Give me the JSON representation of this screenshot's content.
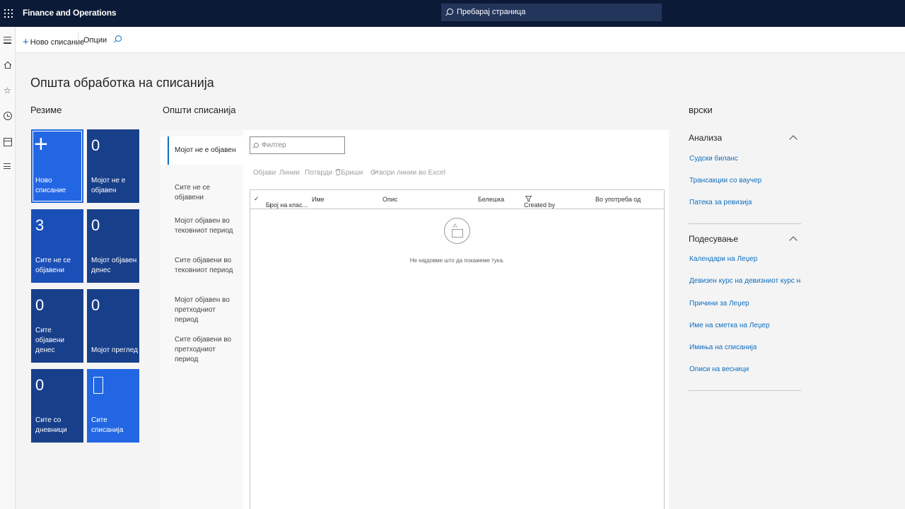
{
  "app": {
    "title": "Finance and Operations"
  },
  "search": {
    "placeholder": "Пребарај страница"
  },
  "actionbar": {
    "new_label": "Ново списание",
    "options_label": "Опции"
  },
  "page": {
    "title": "Општа обработка на списанија"
  },
  "summary": {
    "heading": "Резиме",
    "tiles": [
      {
        "count": "",
        "label": "Ново списание"
      },
      {
        "count": "0",
        "label": "Мојот не е објавен"
      },
      {
        "count": "3",
        "label": "Сите не се објавени"
      },
      {
        "count": "0",
        "label": "Мојот објавен денес"
      },
      {
        "count": "0",
        "label": "Сите објавени денес"
      },
      {
        "count": "0",
        "label": "Мојот преглед"
      },
      {
        "count": "0",
        "label": "Сите со дневници"
      },
      {
        "count": "",
        "label": "Сите списанија"
      }
    ]
  },
  "journals": {
    "heading": "Општи списанија",
    "tabs": [
      "Мојот не е објавен",
      "Сите не се објавени",
      "Мојот објавен во тековниот период",
      "Сите објавени во тековниот период",
      "Мојот објавен во претходниот период",
      "Сите објавени во претходниот период"
    ],
    "filter_placeholder": "Филтер",
    "toolbar": [
      "Објави",
      "Линии",
      "Потврди",
      "Бриши",
      "Отвори линии во Excel"
    ],
    "columns": [
      "Број на клас...",
      "Име",
      "Опис",
      "Белешка",
      "Created by",
      "Во употреба од"
    ],
    "empty_message": "Не најдовме што да покажеме тука."
  },
  "related": {
    "title": "врски",
    "groups": [
      {
        "title": "Анализа",
        "links": [
          "Судски биланс",
          "Трансакции со ваучер",
          "Патека за ревизија"
        ]
      },
      {
        "title": "Подесување",
        "links": [
          "Календари на Леџер",
          "Девизен курс на девизниот курс на ...",
          "Причини за Леџер",
          "Име на сметка на Леџер",
          "Имиња на списанија",
          "Описи на весници"
        ]
      }
    ]
  }
}
